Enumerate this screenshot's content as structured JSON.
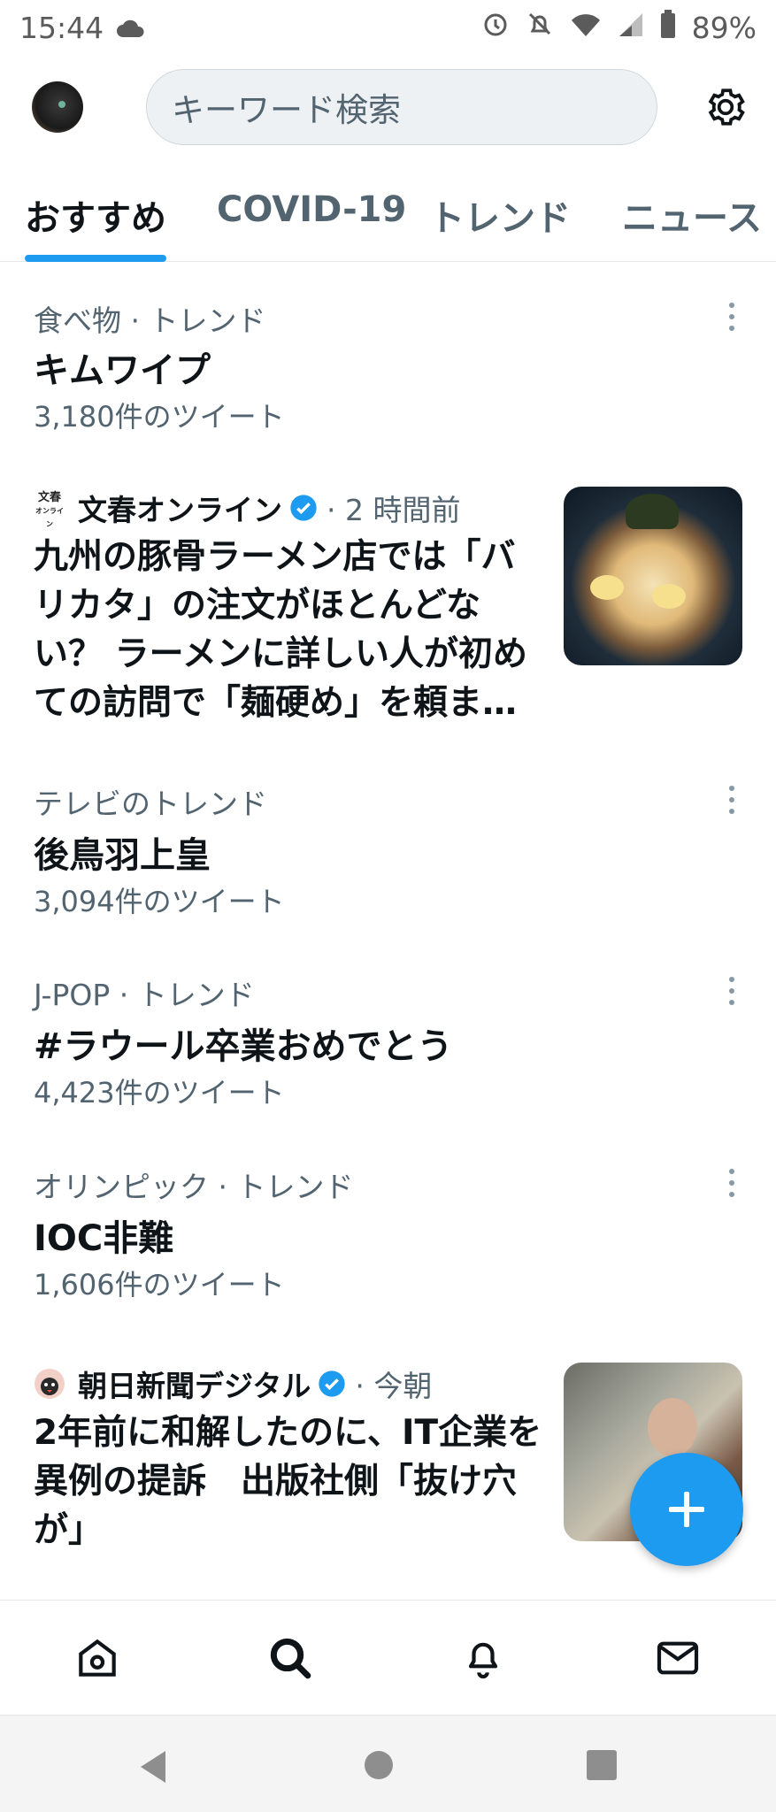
{
  "status_bar": {
    "time": "15:44",
    "battery": "89%",
    "icons": [
      "cloud-icon",
      "alarm-icon",
      "bell-off-icon",
      "wifi-icon",
      "signal-icon",
      "battery-icon"
    ]
  },
  "header": {
    "search_placeholder": "キーワード検索",
    "settings_icon": "gear-icon"
  },
  "tabs": [
    {
      "label": "おすすめ",
      "active": true
    },
    {
      "label": "COVID-19",
      "active": false
    },
    {
      "label": "トレンド",
      "active": false
    },
    {
      "label": "ニュース",
      "active": false
    }
  ],
  "feed": [
    {
      "type": "trend",
      "meta": "食べ物 · トレンド",
      "title": "キムワイプ",
      "count": "3,180件のツイート"
    },
    {
      "type": "news",
      "source": "文春オンライン",
      "logo_text": "文春\nオンライン",
      "time": "· 2 時間前",
      "headline": "九州の豚骨ラーメン店では「バリカタ」の注文がほとんどない？ ラーメンに詳しい人が初めての訪問で「麺硬め」を頼ま…"
    },
    {
      "type": "trend",
      "meta": "テレビのトレンド",
      "title": "後鳥羽上皇",
      "count": "3,094件のツイート"
    },
    {
      "type": "trend",
      "meta": "J-POP · トレンド",
      "title": "#ラウール卒業おめでとう",
      "count": "4,423件のツイート"
    },
    {
      "type": "trend",
      "meta": "オリンピック · トレンド",
      "title": "IOC非難",
      "count": "1,606件のツイート"
    },
    {
      "type": "news",
      "source": "朝日新聞デジタル",
      "time": "· 今朝",
      "headline": "2年前に和解したのに、IT企業を異例の提訴　出版社側「抜け穴が」"
    }
  ],
  "colors": {
    "accent": "#1d9bf0",
    "text": "#0f1419",
    "secondary": "#536471"
  },
  "bottom_nav": [
    "home-icon",
    "search-icon",
    "notifications-icon",
    "messages-icon"
  ],
  "system_nav": [
    "back-icon",
    "home-circle-icon",
    "recents-icon"
  ]
}
